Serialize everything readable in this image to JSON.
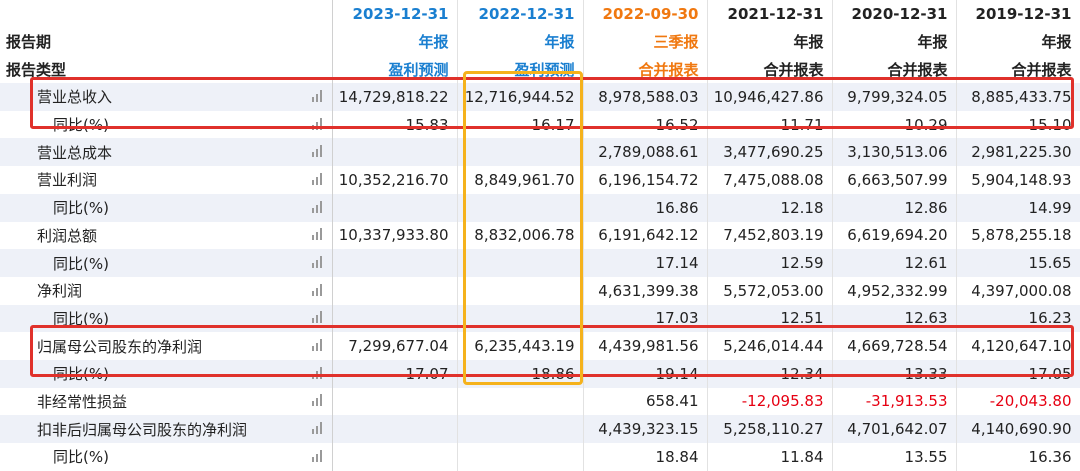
{
  "header": {
    "dates": [
      {
        "text": "2023-12-31",
        "color": "#1a7fd0"
      },
      {
        "text": "2022-12-31",
        "color": "#1a7fd0"
      },
      {
        "text": "2022-09-30",
        "color": "#f07810"
      },
      {
        "text": "2021-12-31",
        "color": "#222222"
      },
      {
        "text": "2020-12-31",
        "color": "#222222"
      },
      {
        "text": "2019-12-31",
        "color": "#222222"
      }
    ],
    "period_label": "报告期",
    "type_label": "报告类型",
    "periods": [
      "年报",
      "年报",
      "三季报",
      "年报",
      "年报",
      "年报"
    ],
    "types": [
      "盈利预测",
      "盈利预测",
      "合并报表",
      "合并报表",
      "合并报表",
      "合并报表"
    ]
  },
  "rows": [
    {
      "label": "营业总收入",
      "indent": 1,
      "values": [
        "14,729,818.22",
        "12,716,944.52",
        "8,978,588.03",
        "10,946,427.86",
        "9,799,324.05",
        "8,885,433.75"
      ]
    },
    {
      "label": "同比(%)",
      "indent": 2,
      "values": [
        "15.83",
        "16.17",
        "16.52",
        "11.71",
        "10.29",
        "15.10"
      ]
    },
    {
      "label": "营业总成本",
      "indent": 1,
      "values": [
        "",
        "",
        "2,789,088.61",
        "3,477,690.25",
        "3,130,513.06",
        "2,981,225.30"
      ]
    },
    {
      "label": "营业利润",
      "indent": 1,
      "values": [
        "10,352,216.70",
        "8,849,961.70",
        "6,196,154.72",
        "7,475,088.08",
        "6,663,507.99",
        "5,904,148.93"
      ]
    },
    {
      "label": "同比(%)",
      "indent": 2,
      "values": [
        "",
        "",
        "16.86",
        "12.18",
        "12.86",
        "14.99"
      ]
    },
    {
      "label": "利润总额",
      "indent": 1,
      "values": [
        "10,337,933.80",
        "8,832,006.78",
        "6,191,642.12",
        "7,452,803.19",
        "6,619,694.20",
        "5,878,255.18"
      ]
    },
    {
      "label": "同比(%)",
      "indent": 2,
      "values": [
        "",
        "",
        "17.14",
        "12.59",
        "12.61",
        "15.65"
      ]
    },
    {
      "label": "净利润",
      "indent": 1,
      "values": [
        "",
        "",
        "4,631,399.38",
        "5,572,053.00",
        "4,952,332.99",
        "4,397,000.08"
      ]
    },
    {
      "label": "同比(%)",
      "indent": 2,
      "values": [
        "",
        "",
        "17.03",
        "12.51",
        "12.63",
        "16.23"
      ]
    },
    {
      "label": "归属母公司股东的净利润",
      "indent": 1,
      "values": [
        "7,299,677.04",
        "6,235,443.19",
        "4,439,981.56",
        "5,246,014.44",
        "4,669,728.54",
        "4,120,647.10"
      ]
    },
    {
      "label": "同比(%)",
      "indent": 2,
      "values": [
        "17.07",
        "18.86",
        "19.14",
        "12.34",
        "13.33",
        "17.05"
      ]
    },
    {
      "label": "非经常性损益",
      "indent": 1,
      "values": [
        "",
        "",
        "658.41",
        "-12,095.83",
        "-31,913.53",
        "-20,043.80"
      ]
    },
    {
      "label": "扣非后归属母公司股东的净利润",
      "indent": 1,
      "values": [
        "",
        "",
        "4,439,323.15",
        "5,258,110.27",
        "4,701,642.07",
        "4,140,690.90"
      ]
    },
    {
      "label": "同比(%)",
      "indent": 2,
      "values": [
        "",
        "",
        "18.84",
        "11.84",
        "13.55",
        "16.36"
      ]
    }
  ],
  "colors": {
    "negative": "#e60012",
    "highlight_red": "#e0312b",
    "highlight_yellow": "#f5b21c",
    "row_stripe": "#eef1f8"
  },
  "icons": {
    "row_chart": "bar-chart-icon"
  }
}
